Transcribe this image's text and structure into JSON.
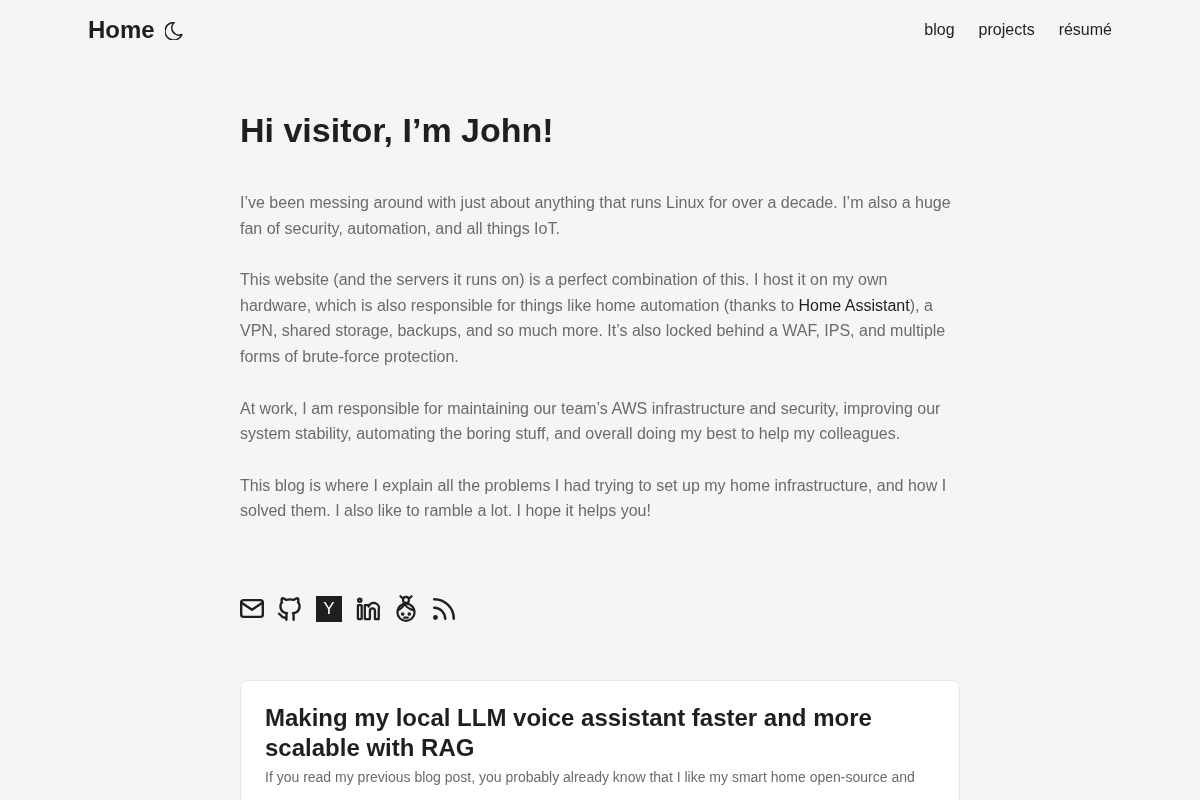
{
  "header": {
    "title": "Home",
    "nav": [
      {
        "label": "blog"
      },
      {
        "label": "projects"
      },
      {
        "label": "résumé"
      }
    ]
  },
  "intro": {
    "heading": "Hi visitor, I’m John!",
    "paragraphs": [
      [
        {
          "kind": "text",
          "text": "I’ve been messing around with just about anything that runs Linux for over a decade. I’m also a huge fan of security, automation, and all things IoT."
        }
      ],
      [
        {
          "kind": "text",
          "text": "This website (and the servers it runs on) is a perfect combination of this. I host it on my own hardware, which is also responsible for things like home automation (thanks to "
        },
        {
          "kind": "link",
          "text": "Home Assistant"
        },
        {
          "kind": "text",
          "text": "), a VPN, shared storage, backups, and so much more. It’s also locked behind a WAF, IPS, and multiple forms of brute-force protection."
        }
      ],
      [
        {
          "kind": "text",
          "text": "At work, I am responsible for maintaining our team’s AWS infrastructure and security, improving our system stability, automating the boring stuff, and overall doing my best to help my colleagues."
        }
      ],
      [
        {
          "kind": "text",
          "text": "This blog is where I explain all the problems I had trying to set up my home infrastructure, and how I solved them. I also like to ramble a lot. I hope it helps you!"
        }
      ]
    ]
  },
  "social_links": [
    {
      "kind": "mail"
    },
    {
      "kind": "github"
    },
    {
      "kind": "letter",
      "text": "Y"
    },
    {
      "kind": "linkedin"
    },
    {
      "kind": "avatar"
    },
    {
      "kind": "rss"
    }
  ],
  "posts": [
    {
      "title": "Making my local LLM voice assistant faster and more scalable with RAG",
      "excerpt": "If you read my previous blog post, you probably already know that I like my smart home open-source and"
    }
  ]
}
